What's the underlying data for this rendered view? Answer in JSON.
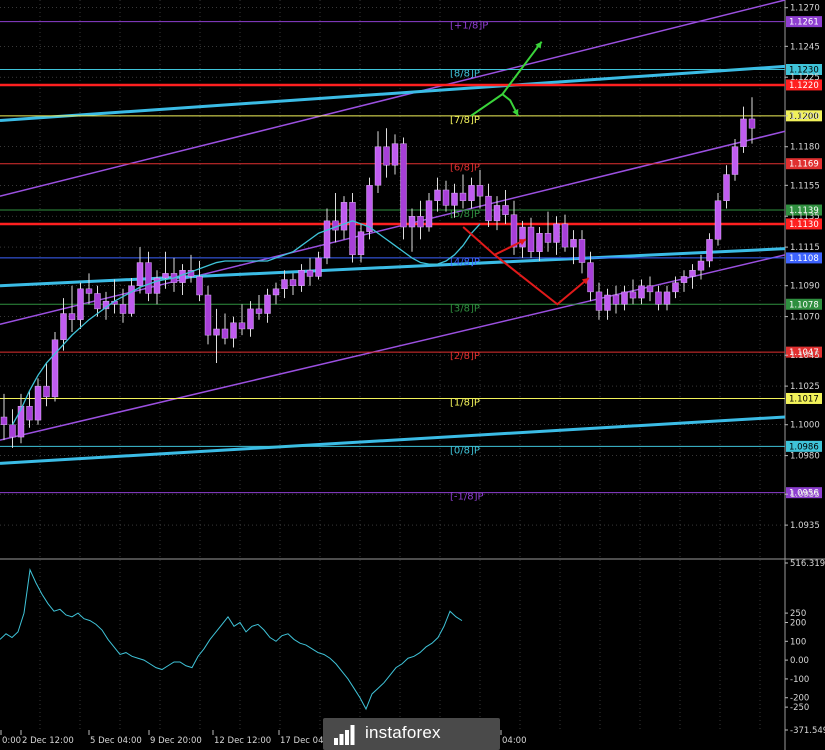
{
  "chart_data": [
    {
      "type": "line",
      "subtype": "candlestick",
      "symbol": "EURUSD",
      "ylim": [
        1.0915,
        1.1275
      ],
      "y_ticks": [
        "1.1270",
        "1.1245",
        "1.1225",
        "1.1200",
        "1.1180",
        "1.1155",
        "1.1135",
        "1.1115",
        "1.1090",
        "1.1070",
        "1.1045",
        "1.1025",
        "1.1000",
        "1.0980",
        "1.0955",
        "1.0935"
      ],
      "x_tick_labels": [
        "0:00",
        "2 Dec 12:00",
        "5 Dec 04:00",
        "9 Dec 20:00",
        "12 Dec 12:00",
        "17 Dec 04:",
        "04:00"
      ],
      "candle_colors": {
        "up": "#b44be6",
        "down": "#b44be6",
        "wick": "#dddddd"
      },
      "moving_average_color": "#3fc3d8",
      "candles": [
        [
          1.1005,
          1.102,
          1.099,
          1.1
        ],
        [
          1.1,
          1.101,
          1.0985,
          1.0992
        ],
        [
          1.0992,
          1.102,
          1.0988,
          1.1012
        ],
        [
          1.1012,
          1.1022,
          1.0998,
          1.1003
        ],
        [
          1.1003,
          1.103,
          1.1,
          1.1025
        ],
        [
          1.1025,
          1.104,
          1.1012,
          1.1018
        ],
        [
          1.1018,
          1.106,
          1.1015,
          1.1055
        ],
        [
          1.1055,
          1.1082,
          1.1048,
          1.1072
        ],
        [
          1.1072,
          1.109,
          1.106,
          1.1068
        ],
        [
          1.1068,
          1.1092,
          1.1062,
          1.1088
        ],
        [
          1.1088,
          1.1098,
          1.1078,
          1.1085
        ],
        [
          1.1085,
          1.109,
          1.107,
          1.1075
        ],
        [
          1.1075,
          1.1086,
          1.1068,
          1.108
        ],
        [
          1.108,
          1.1094,
          1.1072,
          1.1078
        ],
        [
          1.1078,
          1.1088,
          1.1066,
          1.1072
        ],
        [
          1.1072,
          1.1095,
          1.107,
          1.109
        ],
        [
          1.109,
          1.1115,
          1.1085,
          1.1105
        ],
        [
          1.1105,
          1.1112,
          1.108,
          1.1085
        ],
        [
          1.1085,
          1.11,
          1.1078,
          1.1095
        ],
        [
          1.1095,
          1.1112,
          1.1088,
          1.1098
        ],
        [
          1.1098,
          1.1108,
          1.1086,
          1.1092
        ],
        [
          1.1092,
          1.1104,
          1.1084,
          1.11
        ],
        [
          1.11,
          1.111,
          1.1092,
          1.1096
        ],
        [
          1.1096,
          1.1106,
          1.108,
          1.1084
        ],
        [
          1.1084,
          1.109,
          1.1052,
          1.1058
        ],
        [
          1.1058,
          1.1075,
          1.104,
          1.1062
        ],
        [
          1.1062,
          1.1072,
          1.1052,
          1.1056
        ],
        [
          1.1056,
          1.107,
          1.105,
          1.1066
        ],
        [
          1.1066,
          1.1078,
          1.1058,
          1.1062
        ],
        [
          1.1062,
          1.108,
          1.1057,
          1.1075
        ],
        [
          1.1075,
          1.1084,
          1.1068,
          1.1072
        ],
        [
          1.1072,
          1.1088,
          1.1066,
          1.1084
        ],
        [
          1.1084,
          1.1092,
          1.1078,
          1.1088
        ],
        [
          1.1088,
          1.11,
          1.1082,
          1.1094
        ],
        [
          1.1094,
          1.1098,
          1.1084,
          1.109
        ],
        [
          1.109,
          1.1104,
          1.1086,
          1.11
        ],
        [
          1.11,
          1.1108,
          1.109,
          1.1096
        ],
        [
          1.1096,
          1.1112,
          1.1094,
          1.1108
        ],
        [
          1.1108,
          1.114,
          1.1104,
          1.1132
        ],
        [
          1.1132,
          1.115,
          1.1118,
          1.1126
        ],
        [
          1.1126,
          1.1148,
          1.112,
          1.1144
        ],
        [
          1.1144,
          1.115,
          1.1105,
          1.111
        ],
        [
          1.111,
          1.113,
          1.1105,
          1.1125
        ],
        [
          1.1125,
          1.116,
          1.112,
          1.1155
        ],
        [
          1.1155,
          1.119,
          1.115,
          1.118
        ],
        [
          1.118,
          1.1192,
          1.116,
          1.1168
        ],
        [
          1.1168,
          1.1188,
          1.1162,
          1.1182
        ],
        [
          1.1182,
          1.1186,
          1.112,
          1.1128
        ],
        [
          1.1128,
          1.114,
          1.1112,
          1.1135
        ],
        [
          1.1135,
          1.1145,
          1.112,
          1.1128
        ],
        [
          1.1128,
          1.115,
          1.1125,
          1.1145
        ],
        [
          1.1145,
          1.116,
          1.1138,
          1.1152
        ],
        [
          1.1152,
          1.1158,
          1.1138,
          1.1142
        ],
        [
          1.1142,
          1.1156,
          1.1134,
          1.115
        ],
        [
          1.115,
          1.1162,
          1.114,
          1.1145
        ],
        [
          1.1145,
          1.116,
          1.114,
          1.1155
        ],
        [
          1.1155,
          1.1165,
          1.114,
          1.1148
        ],
        [
          1.1148,
          1.1156,
          1.1128,
          1.1132
        ],
        [
          1.1132,
          1.1148,
          1.1126,
          1.1142
        ],
        [
          1.1142,
          1.1152,
          1.113,
          1.1136
        ],
        [
          1.1136,
          1.1145,
          1.111,
          1.1115
        ],
        [
          1.1115,
          1.1132,
          1.1108,
          1.1128
        ],
        [
          1.1128,
          1.1134,
          1.1108,
          1.1112
        ],
        [
          1.1112,
          1.1128,
          1.1106,
          1.1124
        ],
        [
          1.1124,
          1.1138,
          1.1112,
          1.1118
        ],
        [
          1.1118,
          1.1135,
          1.111,
          1.113
        ],
        [
          1.113,
          1.1136,
          1.1112,
          1.1115
        ],
        [
          1.1115,
          1.1126,
          1.1104,
          1.112
        ],
        [
          1.112,
          1.1126,
          1.1098,
          1.1105
        ],
        [
          1.1105,
          1.1112,
          1.108,
          1.1086
        ],
        [
          1.1086,
          1.1092,
          1.1068,
          1.1074
        ],
        [
          1.1074,
          1.1088,
          1.1068,
          1.1084
        ],
        [
          1.1084,
          1.109,
          1.1072,
          1.1078
        ],
        [
          1.1078,
          1.109,
          1.1074,
          1.1086
        ],
        [
          1.1086,
          1.1094,
          1.1078,
          1.1082
        ],
        [
          1.1082,
          1.1094,
          1.1078,
          1.109
        ],
        [
          1.109,
          1.1096,
          1.108,
          1.1086
        ],
        [
          1.1086,
          1.109,
          1.1074,
          1.1078
        ],
        [
          1.1078,
          1.109,
          1.1074,
          1.1086
        ],
        [
          1.1086,
          1.1096,
          1.1082,
          1.1092
        ],
        [
          1.1092,
          1.11,
          1.1086,
          1.1096
        ],
        [
          1.1096,
          1.1104,
          1.1088,
          1.11
        ],
        [
          1.11,
          1.111,
          1.1094,
          1.1106
        ],
        [
          1.1106,
          1.1124,
          1.1102,
          1.112
        ],
        [
          1.112,
          1.115,
          1.1116,
          1.1145
        ],
        [
          1.1145,
          1.1168,
          1.114,
          1.1162
        ],
        [
          1.1162,
          1.1185,
          1.1158,
          1.118
        ],
        [
          1.118,
          1.1206,
          1.1176,
          1.1198
        ],
        [
          1.1198,
          1.1212,
          1.1182,
          1.1192
        ]
      ],
      "moving_average": [
        1.1,
        1.101,
        1.1022,
        1.1032,
        1.104,
        1.1046,
        1.1052,
        1.1058,
        1.1063,
        1.1068,
        1.1072,
        1.1076,
        1.108,
        1.1083,
        1.1086,
        1.1089,
        1.1091,
        1.1093,
        1.1094,
        1.1095,
        1.1097,
        1.1099,
        1.1101,
        1.1103,
        1.1105,
        1.1106,
        1.1106,
        1.1106,
        1.1106,
        1.1106,
        1.1106,
        1.1108,
        1.111,
        1.1112,
        1.1116,
        1.112,
        1.1124,
        1.1126,
        1.1128,
        1.113,
        1.1132,
        1.113,
        1.1128,
        1.1124,
        1.112,
        1.1116,
        1.1112,
        1.1108,
        1.1105,
        1.1104,
        1.1104,
        1.1106,
        1.111,
        1.1116,
        1.1124,
        1.113
      ],
      "murrey_levels": [
        {
          "price": 1.1261,
          "label": "[+1/8]P",
          "color": "#8e3fd0",
          "badge": "1.1261"
        },
        {
          "price": 1.123,
          "label": "[8/8]P",
          "color": "#3fc3d8",
          "badge": "1.1230"
        },
        {
          "price": 1.122,
          "label": "",
          "color": "#ff2020",
          "badge": "1.1220",
          "thick": true
        },
        {
          "price": 1.12,
          "label": "[7/8]P",
          "color": "#f2f25a",
          "badge": "1.1200"
        },
        {
          "price": 1.1169,
          "label": "[6/8]P",
          "color": "#e03030",
          "badge": "1.1169"
        },
        {
          "price": 1.1139,
          "label": "[5/8]P",
          "color": "#2f8f3f",
          "badge": "1.1139"
        },
        {
          "price": 1.113,
          "label": "",
          "color": "#ff2020",
          "badge": "1.1130",
          "thick": true
        },
        {
          "price": 1.1108,
          "label": "[4/8]P",
          "color": "#3d63ff",
          "badge": "1.1108"
        },
        {
          "price": 1.1078,
          "label": "[3/8]P",
          "color": "#2f8f3f",
          "badge": "1.1078"
        },
        {
          "price": 1.1047,
          "label": "[2/8]P",
          "color": "#e03030",
          "badge": "1.1047"
        },
        {
          "price": 1.1017,
          "label": "[1/8]P",
          "color": "#f2f25a",
          "badge": "1.1017"
        },
        {
          "price": 1.0986,
          "label": "[0/8]P",
          "color": "#3fc3d8",
          "badge": "1.0986"
        },
        {
          "price": 1.0956,
          "label": "[-1/8]P",
          "color": "#8e3fd0",
          "badge": "1.0956"
        }
      ],
      "trend_channels": [
        {
          "name": "upper-purple",
          "color": "#9b50e0",
          "from": [
            0,
            1.1148
          ],
          "to": [
            1,
            1.1275
          ]
        },
        {
          "name": "mid-purple",
          "color": "#9b50e0",
          "from": [
            0,
            1.1065
          ],
          "to": [
            1,
            1.119
          ]
        },
        {
          "name": "lower-purple",
          "color": "#9b50e0",
          "from": [
            0,
            1.099
          ],
          "to": [
            1,
            1.111
          ]
        },
        {
          "name": "upper-cyan",
          "color": "#3bbce6",
          "from": [
            0,
            1.1197
          ],
          "to": [
            1,
            1.1232
          ]
        },
        {
          "name": "mid-cyan",
          "color": "#3bbce6",
          "from": [
            0,
            1.109
          ],
          "to": [
            1,
            1.1114
          ]
        },
        {
          "name": "lower-cyan",
          "color": "#3bbce6",
          "from": [
            0,
            1.0975
          ],
          "to": [
            1,
            1.1005
          ]
        }
      ],
      "forecast_arrows": [
        {
          "color": "#3ad43a",
          "points": [
            [
              0.6,
              1.12
            ],
            [
              0.64,
              1.1214
            ],
            [
              0.69,
              1.1248
            ]
          ]
        },
        {
          "color": "#3ad43a",
          "points": [
            [
              0.64,
              1.1214
            ],
            [
              0.65,
              1.121
            ],
            [
              0.66,
              1.12
            ]
          ]
        },
        {
          "color": "#e01a1a",
          "points": [
            [
              0.59,
              1.1128
            ],
            [
              0.63,
              1.111
            ],
            [
              0.67,
              1.112
            ]
          ]
        },
        {
          "color": "#e01a1a",
          "points": [
            [
              0.63,
              1.111
            ],
            [
              0.71,
              1.1078
            ],
            [
              0.75,
              1.1095
            ]
          ]
        }
      ]
    },
    {
      "type": "line",
      "name": "CCI",
      "ylim": [
        -371.5495,
        516.3192
      ],
      "y_ticks": [
        "516.3192",
        "250",
        "200",
        "100",
        "0.00",
        "-100",
        "-200",
        "-250",
        "-371.5495"
      ],
      "values": [
        110,
        140,
        120,
        150,
        250,
        480,
        410,
        350,
        300,
        260,
        270,
        240,
        230,
        250,
        220,
        210,
        190,
        160,
        110,
        70,
        30,
        40,
        20,
        10,
        0,
        -20,
        -40,
        -50,
        -30,
        -10,
        -10,
        -30,
        -40,
        20,
        60,
        110,
        150,
        190,
        230,
        180,
        200,
        150,
        180,
        190,
        160,
        120,
        100,
        130,
        140,
        110,
        90,
        80,
        60,
        40,
        30,
        10,
        -20,
        -60,
        -100,
        -150,
        -200,
        -260,
        -180,
        -150,
        -120,
        -80,
        -40,
        -20,
        10,
        20,
        40,
        70,
        90,
        120,
        180,
        260,
        230,
        210
      ]
    }
  ],
  "watermark": {
    "brand": "instaforex"
  }
}
